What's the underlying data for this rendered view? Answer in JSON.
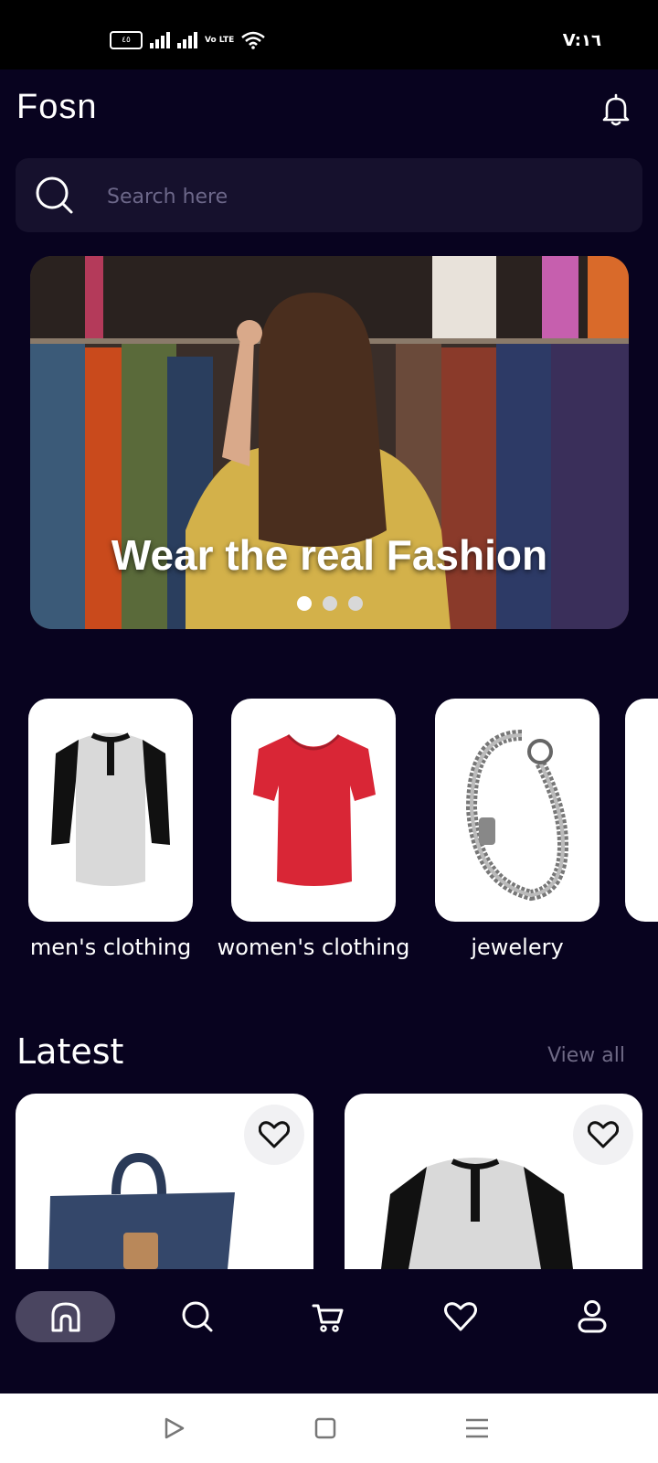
{
  "status_bar": {
    "battery_label": "٤٥",
    "network_label": "Vo LTE",
    "time": "V:١٦"
  },
  "header": {
    "logo_text": "Fosn",
    "bell_icon": "bell-icon"
  },
  "search": {
    "placeholder": "Search here",
    "icon": "search-icon"
  },
  "banner": {
    "title": "Wear the real Fashion",
    "slide_count": 3,
    "active_slide": 1
  },
  "categories": [
    {
      "label": "men's clothing"
    },
    {
      "label": "women's clothing"
    },
    {
      "label": "jewelery"
    }
  ],
  "latest": {
    "title": "Latest",
    "view_all_label": "View all",
    "products": [
      {
        "image": "navy backpack",
        "favorite_icon": "heart-icon"
      },
      {
        "image": "raglan henley shirt",
        "favorite_icon": "heart-icon"
      }
    ]
  },
  "bottom_nav": {
    "items": [
      {
        "icon": "home-icon",
        "active": true
      },
      {
        "icon": "search-icon",
        "active": false
      },
      {
        "icon": "cart-icon",
        "active": false
      },
      {
        "icon": "heart-icon",
        "active": false
      },
      {
        "icon": "profile-icon",
        "active": false
      }
    ]
  },
  "colors": {
    "background": "#08031f",
    "search_bg": "#16112d",
    "nav_active_bg": "#4a4560",
    "muted_text": "#6f6a86"
  }
}
